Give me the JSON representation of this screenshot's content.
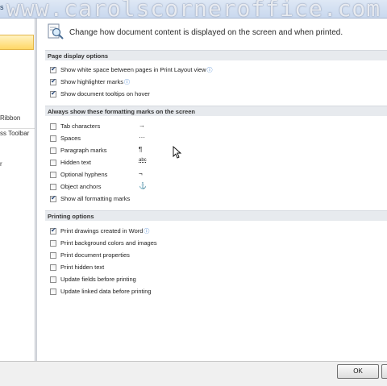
{
  "window": {
    "title": "s"
  },
  "watermark": "www.carolscorneroffice.com",
  "sidebar": {
    "items": [
      {
        "label": "Ribbon"
      },
      {
        "label": "ss Toolbar"
      },
      {
        "label": "r"
      }
    ]
  },
  "header": {
    "description": "Change how document content is displayed on the screen and when printed.",
    "icon": "magnifier-document-icon"
  },
  "sections": {
    "page_display": {
      "title": "Page display options",
      "options": [
        {
          "label": "Show white space between pages in Print Layout view",
          "checked": true,
          "info": true
        },
        {
          "label": "Show highlighter marks",
          "checked": true,
          "info": true
        },
        {
          "label": "Show document tooltips on hover",
          "checked": true
        }
      ]
    },
    "formatting_marks": {
      "title": "Always show these formatting marks on the screen",
      "options": [
        {
          "label": "Tab characters",
          "checked": false,
          "symbol": "→"
        },
        {
          "label": "Spaces",
          "checked": false,
          "symbol": "···"
        },
        {
          "label": "Paragraph marks",
          "checked": false,
          "symbol": "¶"
        },
        {
          "label": "Hidden text",
          "checked": false,
          "symbol": "abc"
        },
        {
          "label": "Optional hyphens",
          "checked": false,
          "symbol": "¬"
        },
        {
          "label": "Object anchors",
          "checked": false,
          "symbol": "⚓"
        },
        {
          "label": "Show all formatting marks",
          "checked": true
        }
      ]
    },
    "printing": {
      "title": "Printing options",
      "options": [
        {
          "label": "Print drawings created in Word",
          "checked": true,
          "info": true
        },
        {
          "label": "Print background colors and images",
          "checked": false
        },
        {
          "label": "Print document properties",
          "checked": false
        },
        {
          "label": "Print hidden text",
          "checked": false
        },
        {
          "label": "Update fields before printing",
          "checked": false
        },
        {
          "label": "Update linked data before printing",
          "checked": false
        }
      ]
    }
  },
  "buttons": {
    "ok": "OK"
  },
  "colors": {
    "selected_sidebar": "#ffd766",
    "section_header": "#e7eaee",
    "info_icon": "#2a70c8"
  }
}
